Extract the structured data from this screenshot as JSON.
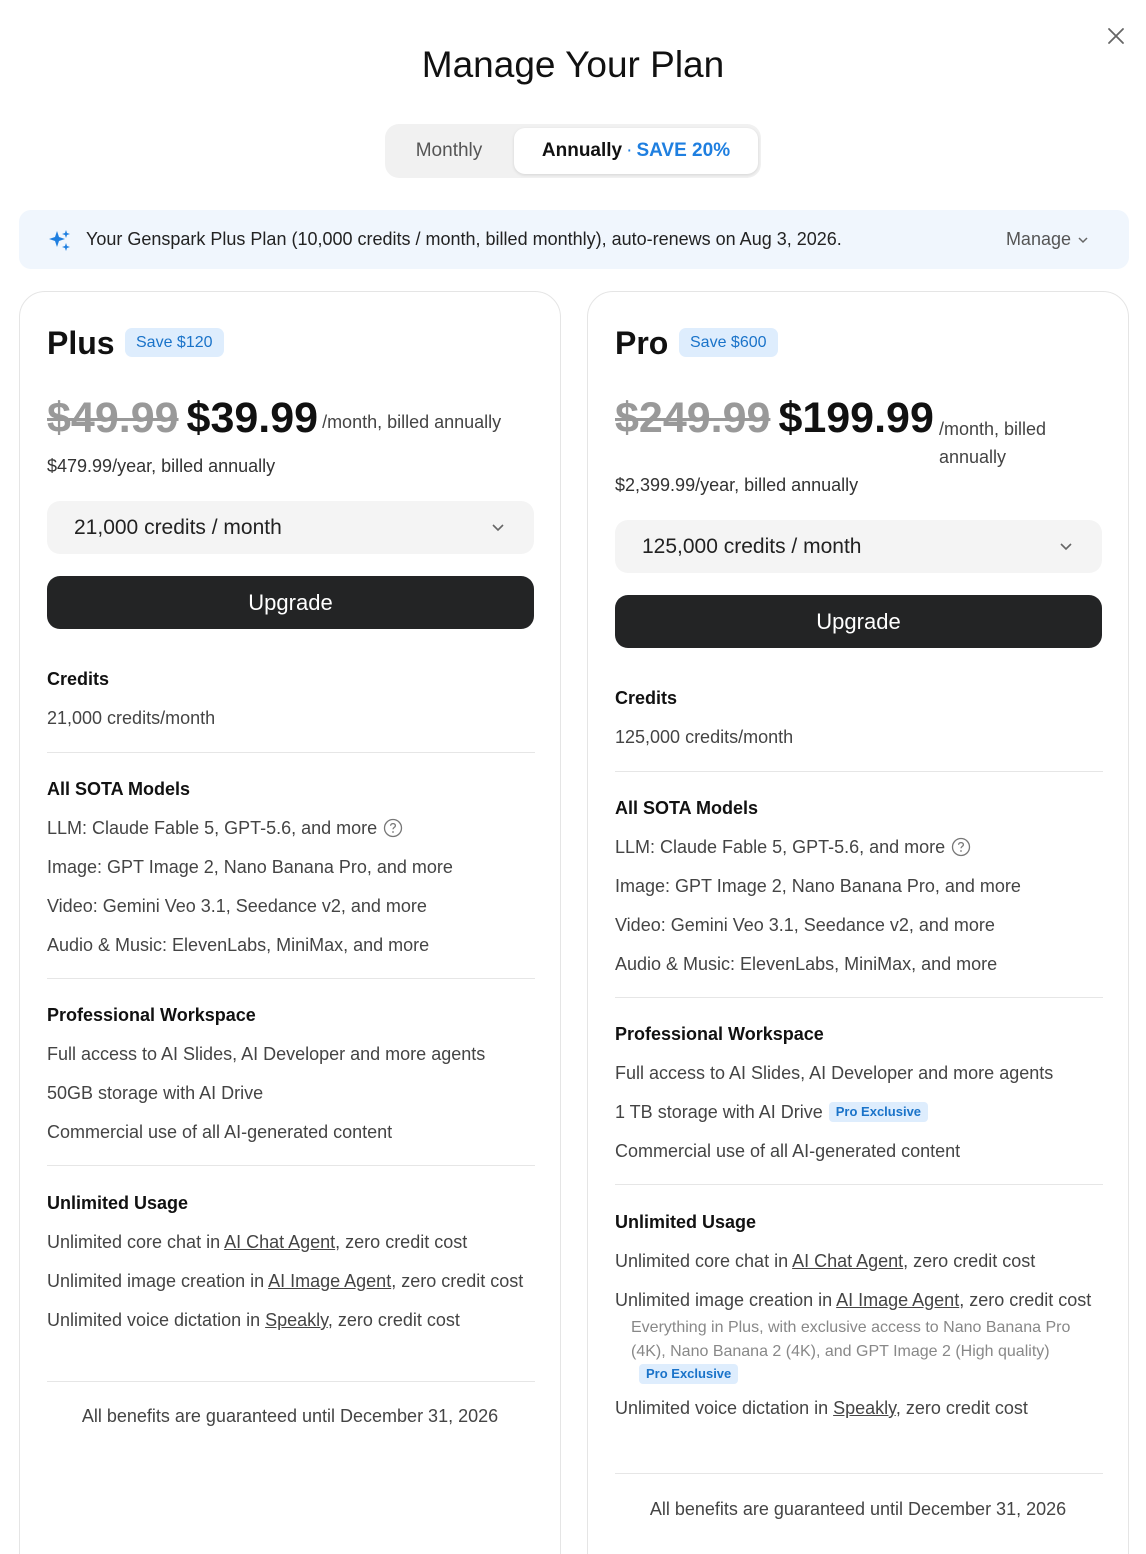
{
  "dialog": {
    "title": "Manage Your Plan"
  },
  "billing_toggle": {
    "monthly_label": "Monthly",
    "annual_label": "Annually",
    "dot": "·",
    "annual_save": "SAVE 20%",
    "selected": "Annually"
  },
  "banner": {
    "text": "Your Genspark Plus Plan (10,000 credits / month, billed monthly), auto-renews on Aug 3, 2026.",
    "manage_label": "Manage",
    "icon": "sparkle-icon"
  },
  "plans": {
    "plus": {
      "name": "Plus",
      "save_badge": "Save $120",
      "old_price": "$49.99",
      "price": "$39.99",
      "per": "/month, billed annually",
      "yearly": "$479.99/year, billed annually",
      "credits_option": "21,000 credits / month",
      "upgrade_label": "Upgrade",
      "credits_title": "Credits",
      "credits_value": "21,000 credits/month",
      "models_title": "All SOTA Models",
      "models": {
        "llm": "LLM: Claude Fable 5, GPT-5.6, and more",
        "image": "Image: GPT Image 2, Nano Banana Pro, and more",
        "video": "Video: Gemini Veo 3.1, Seedance v2, and more",
        "audio": "Audio & Music: ElevenLabs, MiniMax, and more"
      },
      "workspace_title": "Professional Workspace",
      "workspace": {
        "access": "Full access to AI Slides, AI Developer and more agents",
        "storage": "50GB storage with AI Drive",
        "commercial": "Commercial use of all AI-generated content"
      },
      "unlimited_title": "Unlimited Usage",
      "unlimited": {
        "chat_prefix": "Unlimited core chat in ",
        "chat_link": "AI Chat Agent",
        "chat_suffix": ", zero credit cost",
        "image_prefix": "Unlimited image creation in ",
        "image_link": "AI Image Agent",
        "image_suffix": ", zero credit cost",
        "voice_prefix": "Unlimited voice dictation in ",
        "voice_link": "Speakly",
        "voice_suffix": ", zero credit cost"
      },
      "guarantee": "All benefits are guaranteed until December 31, 2026"
    },
    "pro": {
      "name": "Pro",
      "save_badge": "Save $600",
      "old_price": "$249.99",
      "price": "$199.99",
      "per": "/month, billed annually",
      "yearly": "$2,399.99/year, billed annually",
      "credits_option": "125,000 credits / month",
      "upgrade_label": "Upgrade",
      "credits_title": "Credits",
      "credits_value": "125,000 credits/month",
      "models_title": "All SOTA Models",
      "models": {
        "llm": "LLM: Claude Fable 5, GPT-5.6, and more",
        "image": "Image: GPT Image 2, Nano Banana Pro, and more",
        "video": "Video: Gemini Veo 3.1, Seedance v2, and more",
        "audio": "Audio & Music: ElevenLabs, MiniMax, and more"
      },
      "workspace_title": "Professional Workspace",
      "workspace": {
        "access": "Full access to AI Slides, AI Developer and more agents",
        "storage": "1 TB storage with AI Drive",
        "storage_badge": "Pro Exclusive",
        "commercial": "Commercial use of all AI-generated content"
      },
      "unlimited_title": "Unlimited Usage",
      "unlimited": {
        "chat_prefix": "Unlimited core chat in ",
        "chat_link": "AI Chat Agent",
        "chat_suffix": ", zero credit cost",
        "image_prefix": "Unlimited image creation in ",
        "image_link": "AI Image Agent",
        "image_suffix": ", zero credit cost",
        "image_note": "Everything in Plus, with exclusive access to Nano Banana Pro (4K), Nano Banana 2 (4K), and GPT Image 2 (High quality)",
        "image_note_badge": "Pro Exclusive",
        "voice_prefix": "Unlimited voice dictation in ",
        "voice_link": "Speakly",
        "voice_suffix": ", zero credit cost"
      },
      "guarantee": "All benefits are guaranteed until December 31, 2026"
    }
  },
  "colors": {
    "accent": "#1f7fe0",
    "badge_bg": "#deedfd",
    "button_dark": "#232425",
    "banner_bg": "#f0f6fd"
  }
}
